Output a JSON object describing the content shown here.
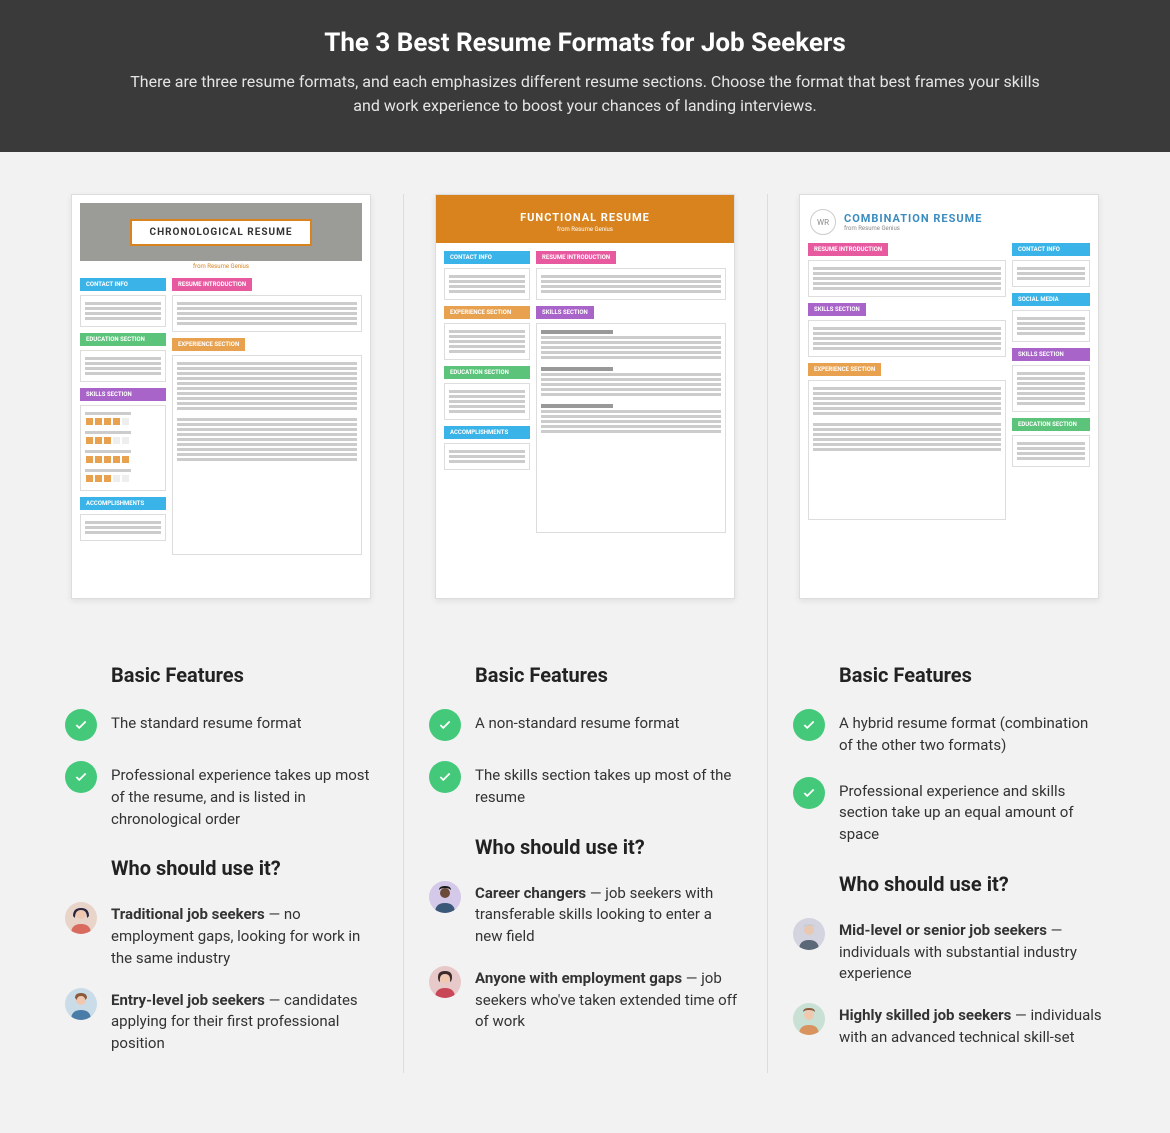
{
  "header": {
    "title": "The 3 Best Resume Formats for Job Seekers",
    "subtitle": "There are three resume formats, and each emphasizes different resume sections. Choose the format that best frames your skills and work experience to boost your chances of landing interviews."
  },
  "columns": [
    {
      "thumb": {
        "title": "CHRONOLOGICAL RESUME",
        "subtitle": "from Resume Genius",
        "tags": {
          "contact": "CONTACT INFO",
          "intro": "RESUME INTRODUCTION",
          "education": "EDUCATION SECTION",
          "skills": "SKILLS SECTION",
          "experience": "EXPERIENCE SECTION",
          "accomplishments": "ACCOMPLISHMENTS"
        }
      },
      "features_heading": "Basic Features",
      "features": [
        "The standard resume format",
        "Professional experience takes up most of the resume, and is listed in chronological order"
      ],
      "who_heading": "Who should use it?",
      "personas": [
        {
          "bold": "Traditional job seekers",
          "rest": " — no employment gaps, looking for work in the same industry",
          "avatar": "avatar1"
        },
        {
          "bold": "Entry-level job seekers",
          "rest": " — candidates applying for their first professional position",
          "avatar": "avatar2"
        }
      ]
    },
    {
      "thumb": {
        "title": "FUNCTIONAL RESUME",
        "subtitle": "from Resume Genius",
        "tags": {
          "contact": "CONTACT INFO",
          "intro": "RESUME INTRODUCTION",
          "experience": "EXPERIENCE SECTION",
          "skills": "SKILLS SECTION",
          "education": "EDUCATION SECTION",
          "accomplishments": "ACCOMPLISHMENTS"
        }
      },
      "features_heading": "Basic Features",
      "features": [
        "A non-standard resume format",
        "The skills section takes up most of the resume"
      ],
      "who_heading": "Who should use it?",
      "personas": [
        {
          "bold": "Career changers",
          "rest": " — job seekers with transferable skills looking to enter a new field",
          "avatar": "avatar3"
        },
        {
          "bold": "Anyone with employment gaps",
          "rest": " — job seekers who've taken extended time off of work",
          "avatar": "avatar4"
        }
      ]
    },
    {
      "thumb": {
        "title": "COMBINATION RESUME",
        "subtitle": "from Resume Genius",
        "initials": "WR",
        "tags": {
          "intro": "RESUME INTRODUCTION",
          "contact": "CONTACT INFO",
          "social": "SOCIAL MEDIA",
          "skills": "SKILLS SECTION",
          "skills2": "SKILLS SECTION",
          "experience": "EXPERIENCE SECTION",
          "education": "EDUCATION SECTION"
        }
      },
      "features_heading": "Basic Features",
      "features": [
        "A hybrid resume format (combination of the other two formats)",
        "Professional experience and skills section take up an equal amount of space"
      ],
      "who_heading": "Who should use it?",
      "personas": [
        {
          "bold": "Mid-level or senior job seekers",
          "rest": " — individuals with substantial industry experience",
          "avatar": "avatar5"
        },
        {
          "bold": "Highly skilled job seekers",
          "rest": " — individuals with an advanced technical skill-set",
          "avatar": "avatar6"
        }
      ]
    }
  ]
}
